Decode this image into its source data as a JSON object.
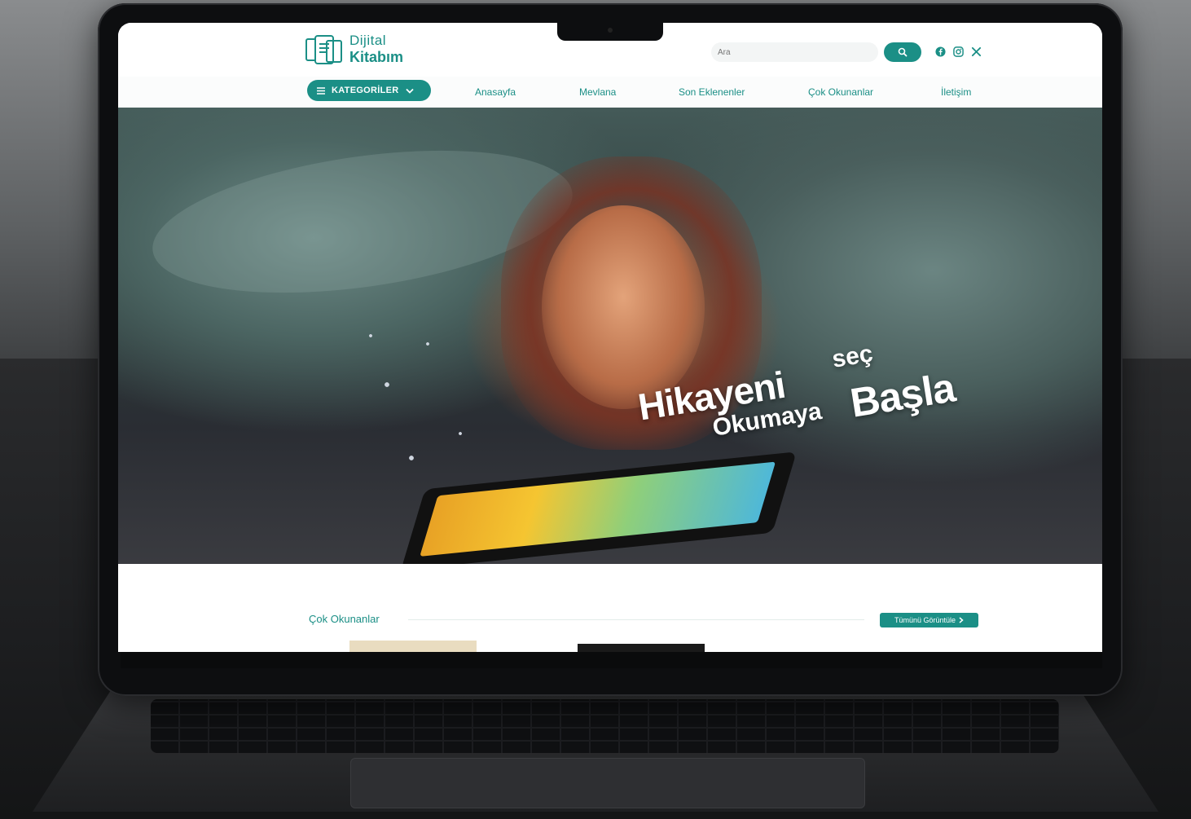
{
  "brand": {
    "line1": "Dijital",
    "line2": "Kitabım",
    "color": "#1b8f86"
  },
  "search": {
    "placeholder": "Ara",
    "icon": "search-icon"
  },
  "social": [
    "facebook-icon",
    "instagram-icon",
    "x-icon"
  ],
  "nav": {
    "categories_label": "KATEGORİLER",
    "links": [
      "Anasayfa",
      "Mevlana",
      "Son Eklenenler",
      "Çok Okunanlar",
      "İletişim"
    ]
  },
  "hero": {
    "tagline": {
      "word1": "Hikayeni",
      "word2": "seç",
      "word3": "Okumaya",
      "word4": "Başla"
    }
  },
  "section": {
    "title": "Çok Okunanlar",
    "view_all": "Tümünü Görüntüle"
  }
}
